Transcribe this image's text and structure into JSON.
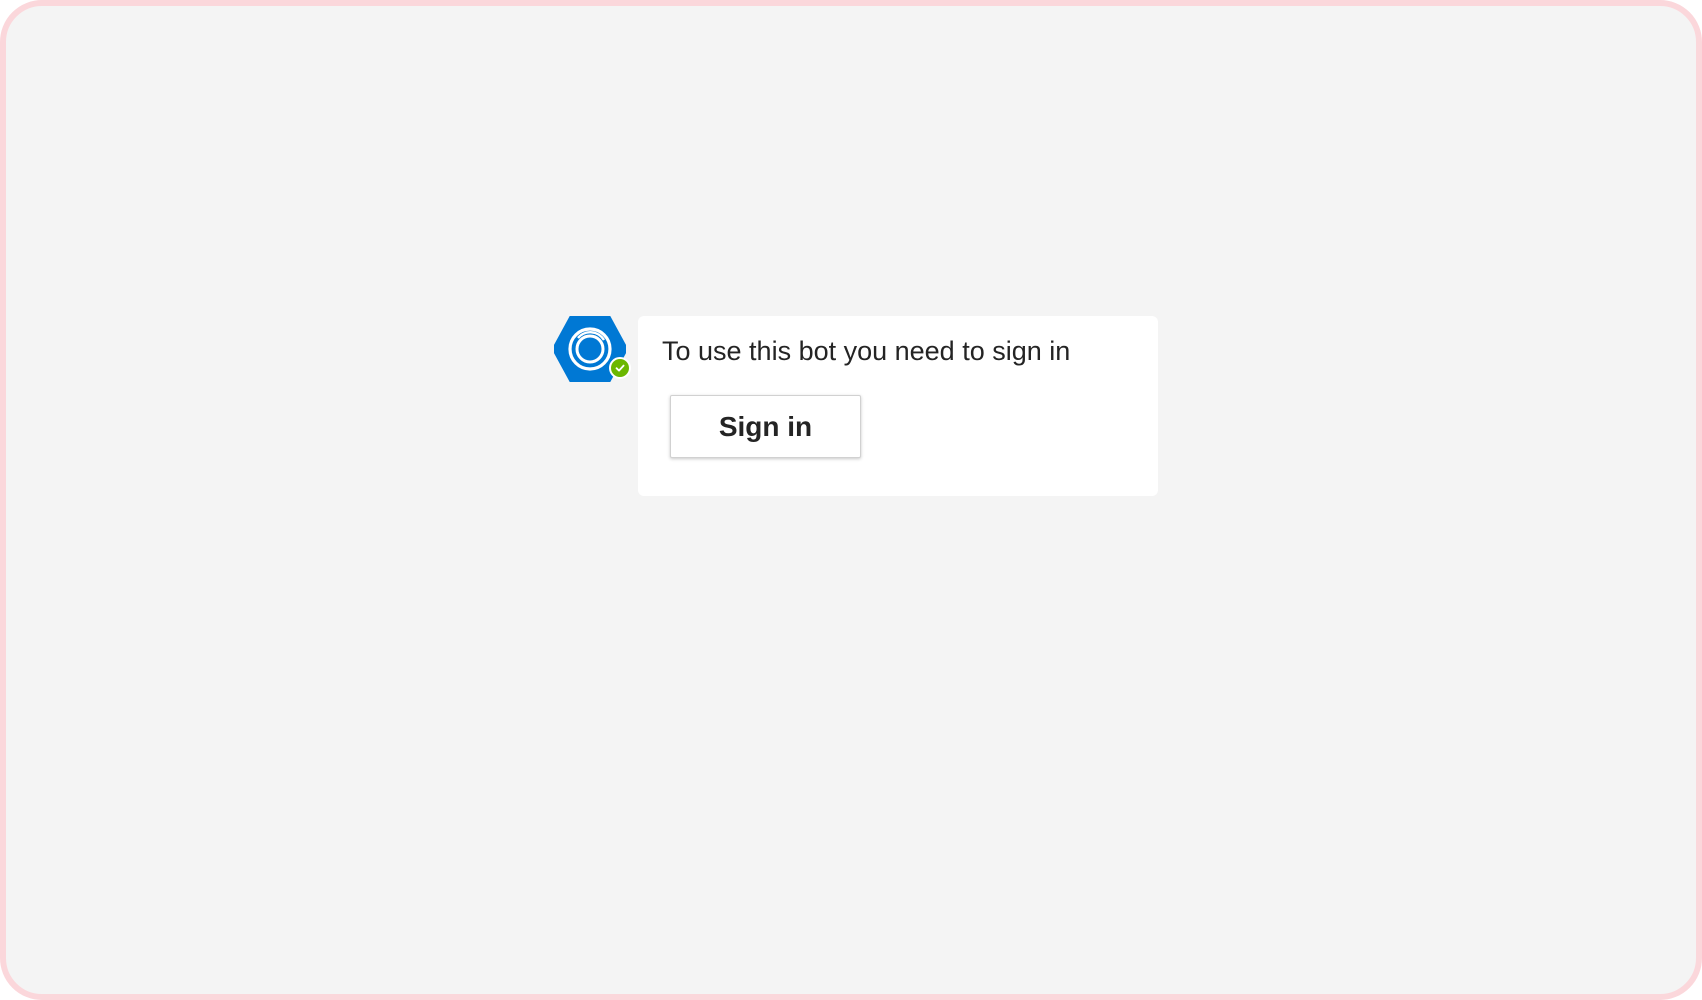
{
  "bot": {
    "avatar_icon": "bot-hexagon-icon",
    "status_icon": "available-check-icon",
    "brand_color": "#0078d4",
    "status_color": "#6bb700"
  },
  "card": {
    "message": "To use this bot you need to sign in",
    "signin_label": "Sign in"
  }
}
